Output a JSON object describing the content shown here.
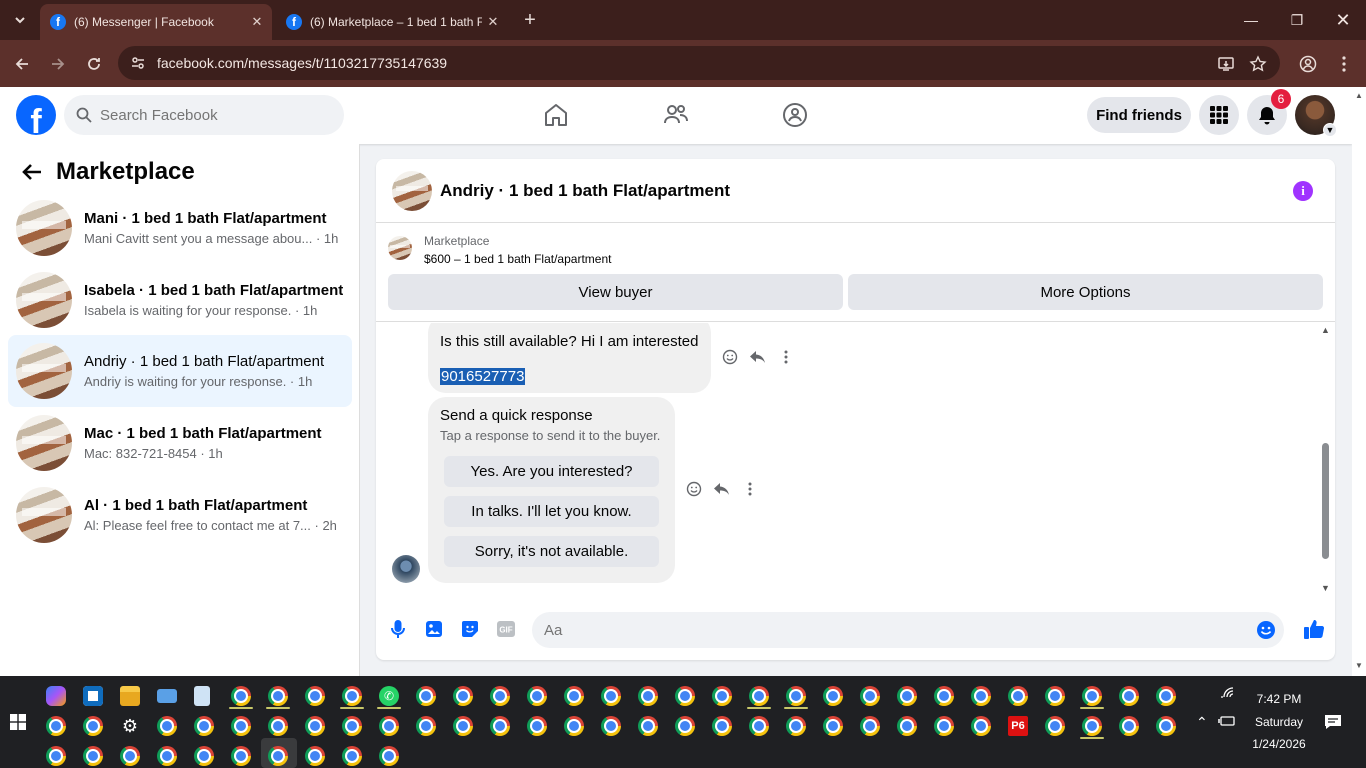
{
  "browser": {
    "tabs": [
      {
        "title": "(6) Messenger | Facebook",
        "active": true
      },
      {
        "title": "(6) Marketplace – 1 bed 1 bath F",
        "active": false
      }
    ],
    "url": "facebook.com/messages/t/1103217735147639"
  },
  "fb_header": {
    "search_placeholder": "Search Facebook",
    "find_friends_label": "Find friends",
    "notification_count": "6"
  },
  "sidebar": {
    "title": "Marketplace",
    "conversations": [
      {
        "name": "Mani · 1 bed 1 bath Flat/apartment",
        "preview": "Mani Cavitt sent you a message abou... · 1h",
        "selected": false
      },
      {
        "name": "Isabela · 1 bed 1 bath Flat/apartment",
        "preview": "Isabela is waiting for your response. · 1h",
        "selected": false
      },
      {
        "name": "Andriy · 1 bed 1 bath Flat/apartment",
        "preview": "Andriy is waiting for your response. · 1h",
        "selected": true
      },
      {
        "name": "Mac · 1 bed 1 bath Flat/apartment",
        "preview": "Mac: 832-721-8454 · 1h",
        "selected": false
      },
      {
        "name": "Al · 1 bed 1 bath Flat/apartment",
        "preview": "Al: Please feel free to contact me at 7... · 2h",
        "selected": false
      }
    ]
  },
  "chat": {
    "title": "Andriy · 1 bed 1 bath Flat/apartment",
    "listing_label": "Marketplace",
    "listing_price": "$600 – 1 bed 1 bath Flat/apartment",
    "view_buyer_label": "View buyer",
    "more_options_label": "More Options",
    "message_text": "Is this still available? Hi I am interested",
    "message_phone": "9016527773",
    "quick_response_title": "Send a quick response",
    "quick_response_subtitle": "Tap a response to send it to the buyer.",
    "quick_responses": [
      "Yes. Are you interested?",
      "In talks. I'll let you know.",
      "Sorry, it's not available."
    ],
    "composer_placeholder": "Aa"
  },
  "taskbar": {
    "time": "7:42 PM",
    "day": "Saturday",
    "date": "1/24/2026"
  },
  "colors": {
    "fb_blue": "#0866ff",
    "chrome_frame": "#3c1f1c",
    "selected_row": "#ebf5ff",
    "badge_red": "#e41e3f",
    "info_purple": "#a033ff"
  }
}
